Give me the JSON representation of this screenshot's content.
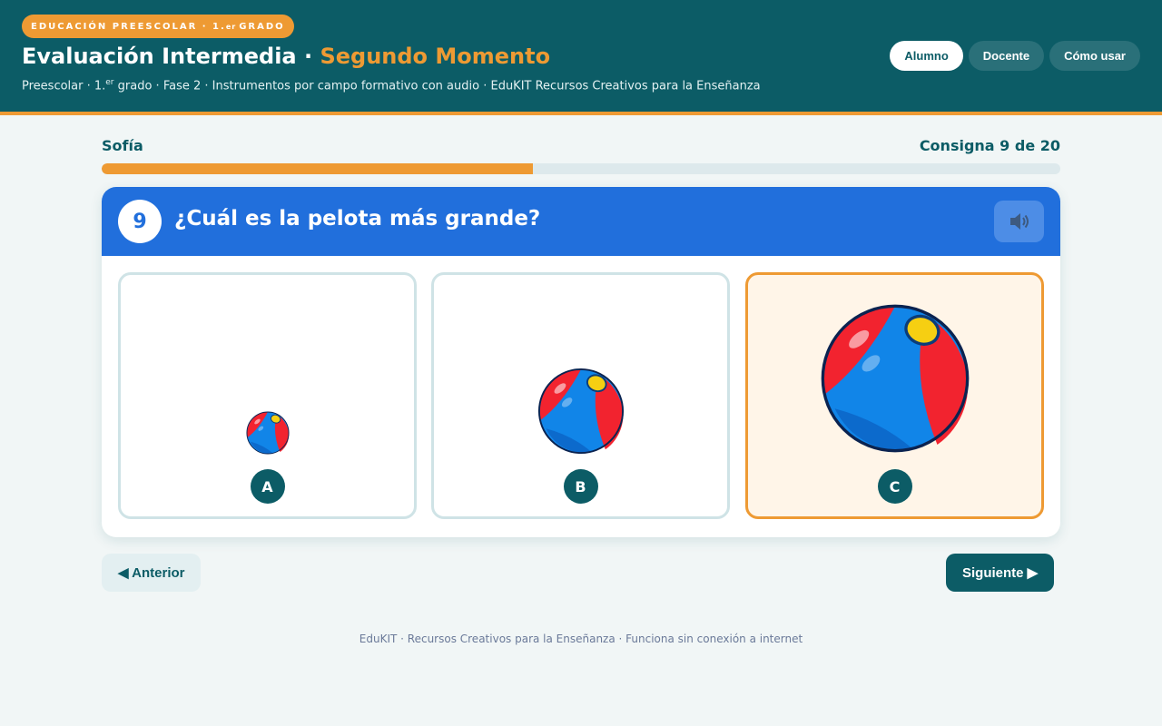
{
  "header": {
    "badge_main": "EDUCACIÓN PREESCOLAR · 1.",
    "badge_sup": "er",
    "badge_tail": "GRADO",
    "title_main": "Evaluación Intermedia",
    "title_sep": " · ",
    "title_accent": "Segundo Momento",
    "subtitle_pre": "Preescolar · 1.",
    "subtitle_sup": "er",
    "subtitle_post": " grado · Fase 2 · Instrumentos por campo formativo con audio · EduKIT Recursos Creativos para la Enseñanza",
    "nav": [
      {
        "label": "Alumno",
        "active": true
      },
      {
        "label": "Docente",
        "active": false
      },
      {
        "label": "Cómo usar",
        "active": false
      }
    ]
  },
  "progress": {
    "student": "Sofía",
    "counter": "Consigna 9 de 20",
    "fraction": 0.45
  },
  "question": {
    "number": "9",
    "text": "¿Cuál es la pelota más grande?",
    "audio_icon": "speaker-icon",
    "options": [
      {
        "letter": "A",
        "image": "small-beach-ball",
        "selected": false
      },
      {
        "letter": "B",
        "image": "medium-beach-ball",
        "selected": false
      },
      {
        "letter": "C",
        "image": "large-beach-ball",
        "selected": true
      }
    ]
  },
  "nav": {
    "prev": "◀ Anterior",
    "next": "Siguiente ▶"
  },
  "footer": "EduKIT · Recursos Creativos para la Enseñanza · Funciona sin conexión a internet",
  "colors": {
    "primary": "#0c5c66",
    "accent": "#ee9a33",
    "question_bar": "#216fdc",
    "selected_bg": "#fff5e8"
  }
}
